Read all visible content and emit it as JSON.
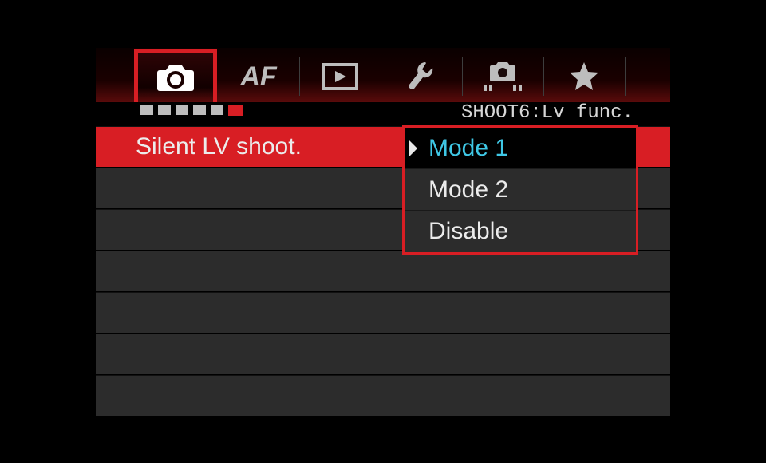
{
  "tabs": [
    {
      "name": "shoot-tab",
      "icon": "camera",
      "active": true
    },
    {
      "name": "af-tab",
      "label": "AF",
      "active": false
    },
    {
      "name": "playback-tab",
      "icon": "play",
      "active": false
    },
    {
      "name": "setup-tab",
      "icon": "wrench",
      "active": false
    },
    {
      "name": "custom-tab",
      "icon": "camera-dots",
      "active": false
    },
    {
      "name": "my-menu-tab",
      "icon": "star",
      "active": false
    }
  ],
  "pagination": {
    "total": 6,
    "active_index": 5
  },
  "page_title": "SHOOT6:Lv func.",
  "menu": {
    "label": "Silent LV shoot.",
    "options": [
      {
        "label": "Mode 1",
        "selected": true
      },
      {
        "label": "Mode 2",
        "selected": false
      },
      {
        "label": "Disable",
        "selected": false
      }
    ]
  }
}
